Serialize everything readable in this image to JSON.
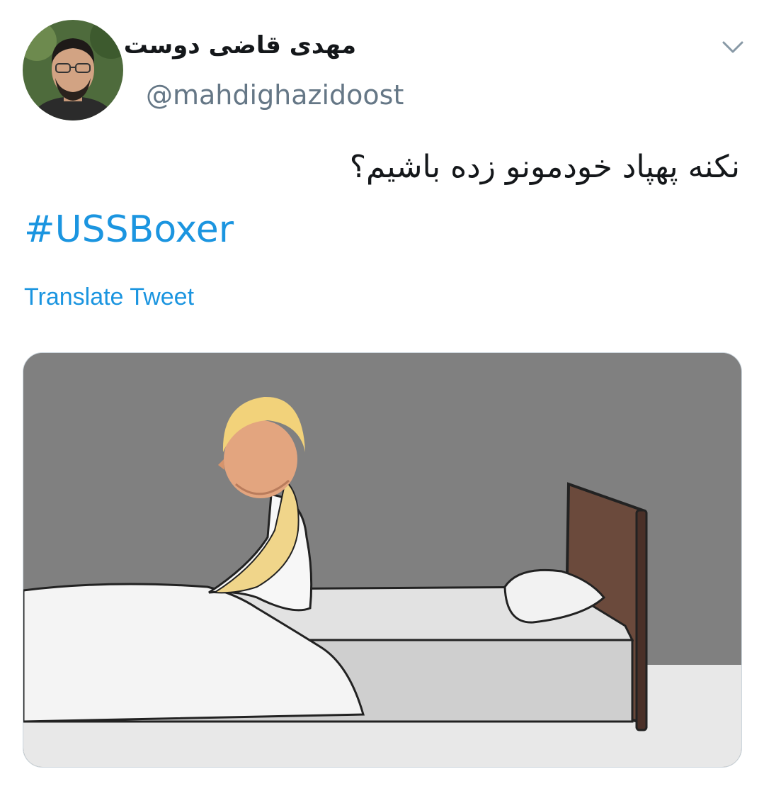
{
  "tweet": {
    "author": {
      "display_name": "مهدی قاضی دوست",
      "handle": "@mahdighazidoost",
      "avatar_icon": "profile-photo"
    },
    "menu_icon": "chevron-down-icon",
    "text": "نکنه پهپاد خودمونو زده باشیم؟",
    "hashtag": "#USSBoxer",
    "translate_label": "Translate Tweet",
    "media": {
      "description_icon": "meme-cartoon-image"
    }
  },
  "colors": {
    "link": "#1b95e0",
    "text": "#14171a",
    "secondary": "#657786",
    "wall": "#808080"
  }
}
